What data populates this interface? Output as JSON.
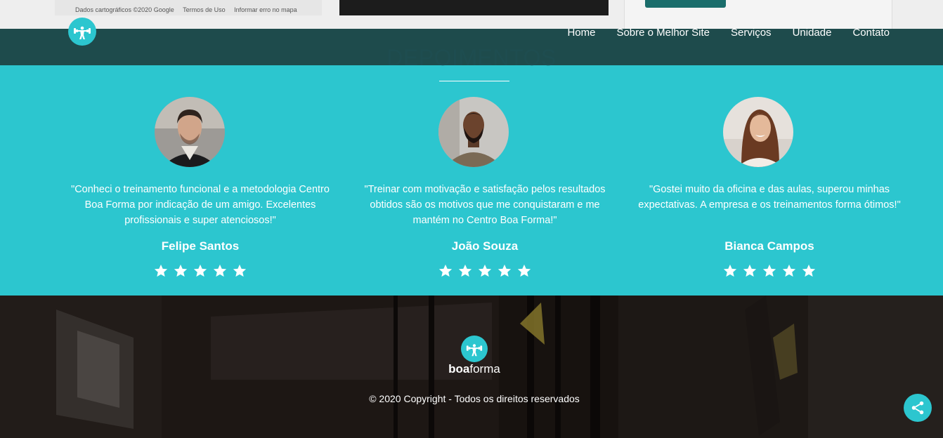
{
  "top_strip": {
    "map_attribution": [
      "Dados cartográficos ©2020 Google",
      "Termos de Uso",
      "Informar erro no mapa"
    ]
  },
  "header": {
    "logo_icon": "weightlifter-icon",
    "nav": [
      "Home",
      "Sobre o Melhor Site",
      "Serviços",
      "Unidade",
      "Contato"
    ]
  },
  "testimonials": {
    "title": "DEPOIMENTOS",
    "items": [
      {
        "quote": "\"Conheci o treinamento funcional e a metodologia Centro Boa Forma por indicação de um amigo. Excelentes profissionais e super atenciosos!\"",
        "name": "Felipe Santos",
        "rating": 5
      },
      {
        "quote": "\"Treinar com motivação e satisfação pelos resultados obtidos são os motivos que me conquistaram e me mantém no Centro Boa Forma!\"",
        "name": "João Souza",
        "rating": 5
      },
      {
        "quote": "\"Gostei muito da oficina e das aulas, superou minhas expectativas. A empresa e os treinamentos forma ótimos!\"",
        "name": "Bianca Campos",
        "rating": 5
      }
    ]
  },
  "footer": {
    "brand_bold": "boa",
    "brand_light": "forma",
    "copyright": "© 2020 Copyright - Todos os direitos reservados",
    "share_icon": "share-icon"
  },
  "colors": {
    "accent": "#2cc6cf",
    "header_bg": "#0e3e40",
    "footer_bg": "#161211"
  }
}
